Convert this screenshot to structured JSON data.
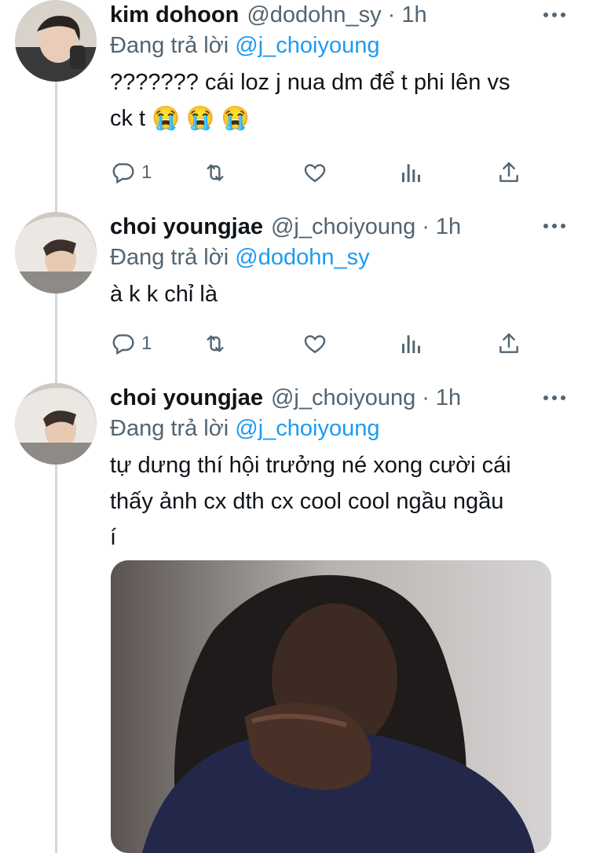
{
  "colors": {
    "text": "#0f1419",
    "secondary": "#536471",
    "link": "#1d9bf0",
    "thread_line": "#cfd9de"
  },
  "tweets": [
    {
      "name": "kim dohoon",
      "handle": "@dodohn_sy",
      "separator": "·",
      "time": "1h",
      "reply_prefix": "Đang trả lời",
      "reply_mention": "@j_choiyoung",
      "lines": [
        "??????? cái loz j nua dm để t phi lên vs",
        "ck t 😭 😭 😭"
      ],
      "reply_count": "1",
      "avatar_icon": "profile-photo"
    },
    {
      "name": "choi youngjae",
      "handle": "@j_choiyoung",
      "separator": "·",
      "time": "1h",
      "reply_prefix": "Đang trả lời",
      "reply_mention": "@dodohn_sy",
      "lines": [
        "à k k chỉ là"
      ],
      "reply_count": "1",
      "avatar_icon": "profile-photo"
    },
    {
      "name": "choi youngjae",
      "handle": "@j_choiyoung",
      "separator": "·",
      "time": "1h",
      "reply_prefix": "Đang trả lời",
      "reply_mention": "@j_choiyoung",
      "lines": [
        "tự dưng thí hội trưởng né xong cười cái",
        "thấy ảnh cx dth cx cool cool ngầu ngầu",
        "í"
      ],
      "avatar_icon": "profile-photo",
      "media_icon": "attached-photo"
    }
  ],
  "icons": {
    "reply": "reply-icon",
    "retweet": "retweet-icon",
    "like": "heart-icon",
    "views": "views-icon",
    "share": "share-icon",
    "more": "more-icon"
  }
}
